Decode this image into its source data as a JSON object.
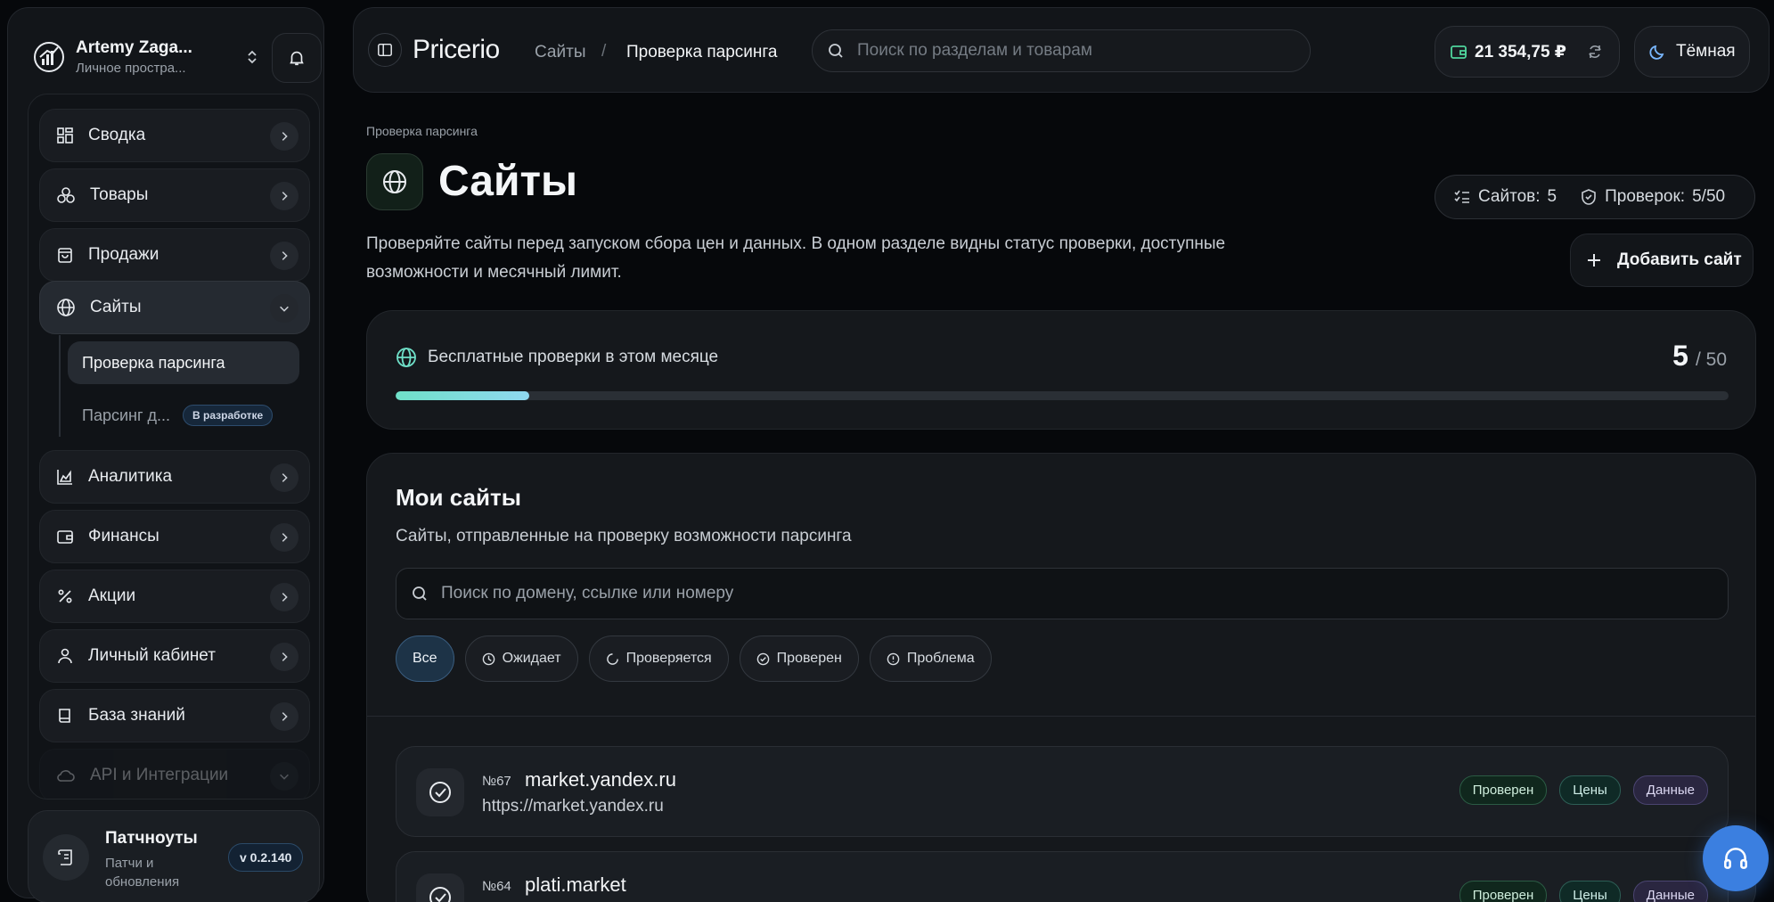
{
  "user": {
    "name": "Artemy Zaga...",
    "space": "Личное простра..."
  },
  "sidebar": {
    "items": [
      {
        "label": "Сводка"
      },
      {
        "label": "Товары"
      },
      {
        "label": "Продажи"
      },
      {
        "label": "Сайты"
      },
      {
        "label": "Аналитика"
      },
      {
        "label": "Финансы"
      },
      {
        "label": "Акции"
      },
      {
        "label": "Личный кабинет"
      },
      {
        "label": "База знаний"
      },
      {
        "label": "API и Интеграции"
      }
    ],
    "sub_items": [
      {
        "label": "Проверка парсинга"
      },
      {
        "label": "Парсинг д...",
        "badge": "В разработке"
      }
    ]
  },
  "patch": {
    "title": "Патчноуты",
    "subtitle": "Патчи и обновления",
    "version": "v 0.2.140"
  },
  "header": {
    "brand": "Pricerio",
    "breadcrumb": [
      "Сайты",
      "Проверка парсинга"
    ],
    "breadcrumb_sep": "/",
    "search_placeholder": "Поиск по разделам и товарам",
    "balance": "21 354,75 ₽",
    "theme_label": "Тёмная"
  },
  "page": {
    "breadcrumb": "Проверка парсинга",
    "title": "Сайты",
    "description": "Проверяйте сайты перед запуском сбора цен и данных. В одном разделе видны статус проверки, доступные возможности и месячный лимит.",
    "stats": {
      "sites_label": "Сайтов:",
      "sites_value": "5",
      "checks_label": "Проверок:",
      "checks_value": "5/50"
    },
    "add_button": "Добавить сайт"
  },
  "quota": {
    "label": "Бесплатные проверки в этом месяце",
    "used": "5",
    "max": "/ 50",
    "progress_fraction": 0.1
  },
  "sites": {
    "title": "Мои сайты",
    "subtitle": "Сайты, отправленные на проверку возможности парсинга",
    "search_placeholder": "Поиск по домену, ссылке или номеру",
    "filters": [
      "Все",
      "Ожидает",
      "Проверяется",
      "Проверен",
      "Проблема"
    ],
    "rows": [
      {
        "number": "№67",
        "domain": "market.yandex.ru",
        "url": "https://market.yandex.ru",
        "badges": [
          "Проверен",
          "Цены",
          "Данные"
        ]
      },
      {
        "number": "№64",
        "domain": "plati.market",
        "url": "",
        "badges": [
          "Проверен",
          "Цены",
          "Данные"
        ]
      }
    ]
  },
  "colors": {
    "accent": "#3b7fe0",
    "progress": "#6fe0c8",
    "background": "#06080b"
  }
}
